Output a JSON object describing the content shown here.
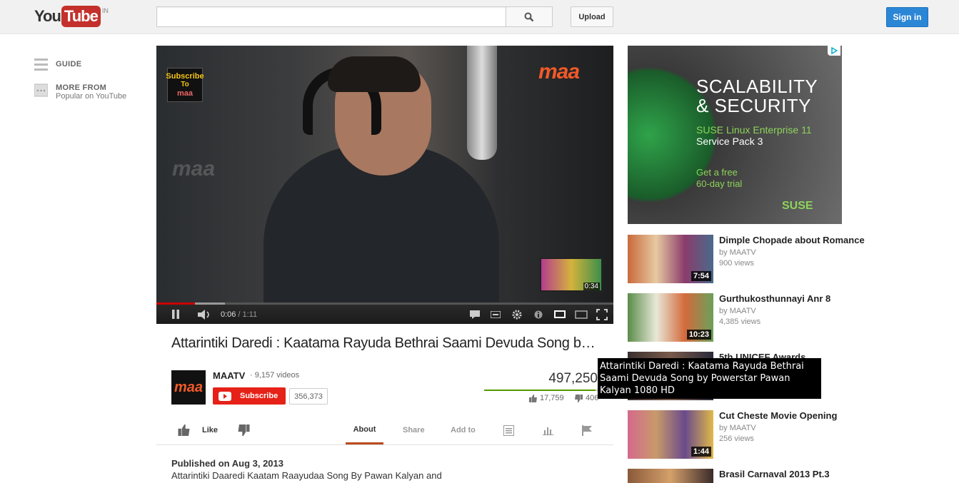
{
  "header": {
    "logo_you": "You",
    "logo_tube": "Tube",
    "logo_country": "IN",
    "search_placeholder": "",
    "upload_label": "Upload",
    "signin_label": "Sign in"
  },
  "guide": {
    "guide_label": "GUIDE",
    "more_from_label": "MORE FROM",
    "more_from_sub": "Popular on YouTube"
  },
  "player": {
    "overlay_subscribe": "Subscribe",
    "overlay_to": "To",
    "overlay_brand": "maa",
    "corner_logo": "maa",
    "watermark": "maa",
    "endcard_duration": "0:34",
    "current_time": "0:06",
    "separator": "/",
    "total_time": "1:11",
    "progress_fraction": 0.085,
    "buffer_fraction": 0.15
  },
  "video": {
    "title": "Attarintiki Daredi : Kaatama Rayuda Bethrai Saami Devuda Song by Powerstar Pawan Kalyan 1080 HD",
    "channel_avatar": "maa",
    "channel_name": "MAATV",
    "video_count": "· 9,157 videos",
    "subscribe_label": "Subscribe",
    "subscriber_count": "356,373",
    "views": "497,250",
    "likes": "17,759",
    "dislikes": "406",
    "like_fraction": 0.977,
    "published": "Published on Aug 3, 2013",
    "description": "Attarintiki Daaredi Kaatam Raayudaa Song By Pawan Kalyan and"
  },
  "actions": {
    "like": "Like",
    "about": "About",
    "share": "Share",
    "add_to": "Add to"
  },
  "ad": {
    "headline_1": "SCALABILITY",
    "headline_2": "& SECURITY",
    "product_1": "SUSE Linux Enterprise 11",
    "product_2": "Service Pack 3",
    "offer_1": "Get a free",
    "offer_2": "60-day trial",
    "brand": "SUSE"
  },
  "related": [
    {
      "title": "Dimple Chopade about Romance",
      "by": "by MAATV",
      "views": "900 views",
      "duration": "7:54"
    },
    {
      "title": "Gurthukosthunnayi Anr 8",
      "by": "by MAATV",
      "views": "4,385 views",
      "duration": "10:23"
    },
    {
      "title": "5th UNICEF Awards",
      "by": "",
      "views": "",
      "duration": ""
    },
    {
      "title": "Cut Cheste Movie Opening",
      "by": "by MAATV",
      "views": "256 views",
      "duration": "1:44"
    },
    {
      "title": "Brasil Carnaval 2013 Pt.3",
      "by": "",
      "views": "",
      "duration": ""
    }
  ],
  "tooltip": {
    "text": "Attarintiki Daredi : Kaatama Rayuda Bethrai Saami Devuda Song by Powerstar Pawan Kalyan 1080 HD"
  },
  "colors": {
    "brand_red": "#c4302b",
    "subscribe_red": "#e62117",
    "signin_blue": "#2c86d6",
    "like_green": "#559900",
    "about_underline": "#b94a1c",
    "suse_green": "#8dd35a"
  }
}
